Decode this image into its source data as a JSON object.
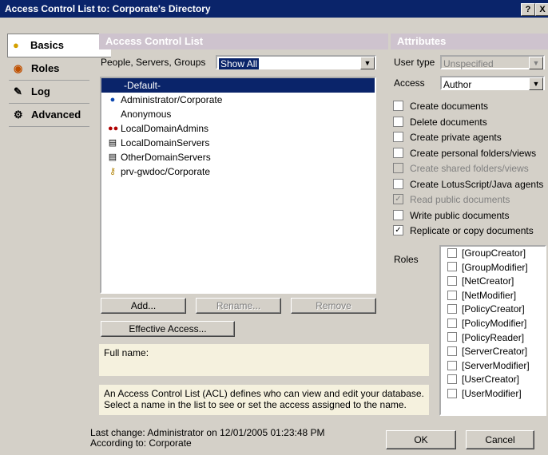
{
  "window": {
    "title": "Access Control List to: Corporate's Directory",
    "help_btn": "?",
    "close_btn": "X"
  },
  "sidebar": {
    "items": [
      {
        "label": "Basics",
        "icon": "person-icon"
      },
      {
        "label": "Roles",
        "icon": "roles-icon"
      },
      {
        "label": "Log",
        "icon": "log-icon"
      },
      {
        "label": "Advanced",
        "icon": "advanced-icon"
      }
    ]
  },
  "acl": {
    "header": "Access Control List",
    "filter_label": "People, Servers, Groups",
    "filter_value": "Show All",
    "entries": [
      {
        "name": "-Default-",
        "icon": ""
      },
      {
        "name": "Administrator/Corporate",
        "icon": "person-icon"
      },
      {
        "name": "Anonymous",
        "icon": ""
      },
      {
        "name": "LocalDomainAdmins",
        "icon": "group-icon"
      },
      {
        "name": "LocalDomainServers",
        "icon": "server-icon"
      },
      {
        "name": "OtherDomainServers",
        "icon": "server-icon"
      },
      {
        "name": "prv-gwdoc/Corporate",
        "icon": "user-key-icon"
      }
    ],
    "add_btn": "Add...",
    "rename_btn": "Rename...",
    "remove_btn": "Remove",
    "effective_btn": "Effective Access...",
    "fullname_label": "Full name:",
    "info_line1": "An Access Control List (ACL) defines who can view and edit your database.",
    "info_line2": "Select a name in the list to see or set the access assigned to the name."
  },
  "attributes": {
    "header": "Attributes",
    "user_type_label": "User type",
    "user_type_value": "Unspecified",
    "access_label": "Access",
    "access_value": "Author",
    "checkboxes": [
      {
        "label": "Create documents",
        "checked": false,
        "disabled": false
      },
      {
        "label": "Delete documents",
        "checked": false,
        "disabled": false
      },
      {
        "label": "Create private agents",
        "checked": false,
        "disabled": false
      },
      {
        "label": "Create personal folders/views",
        "checked": false,
        "disabled": false
      },
      {
        "label": "Create shared folders/views",
        "checked": false,
        "disabled": true
      },
      {
        "label": "Create LotusScript/Java agents",
        "checked": false,
        "disabled": false
      },
      {
        "label": "Read public documents",
        "checked": true,
        "disabled": true
      },
      {
        "label": "Write public documents",
        "checked": false,
        "disabled": false
      },
      {
        "label": "Replicate or copy documents",
        "checked": true,
        "disabled": false
      }
    ],
    "roles_label": "Roles",
    "roles": [
      "[GroupCreator]",
      "[GroupModifier]",
      "[NetCreator]",
      "[NetModifier]",
      "[PolicyCreator]",
      "[PolicyModifier]",
      "[PolicyReader]",
      "[ServerCreator]",
      "[ServerModifier]",
      "[UserCreator]",
      "[UserModifier]"
    ]
  },
  "footer": {
    "last_change": "Last change: Administrator on 12/01/2005 01:23:48 PM",
    "according_to": "According to: Corporate",
    "ok_btn": "OK",
    "cancel_btn": "Cancel"
  }
}
